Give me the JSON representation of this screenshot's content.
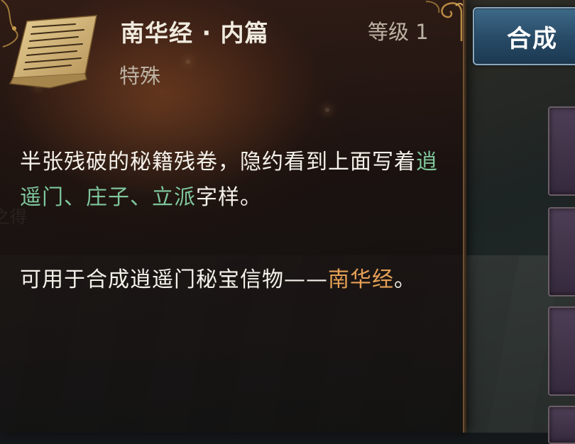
{
  "item": {
    "name": "南华经 · 内篇",
    "level": "等级 1",
    "category": "特殊",
    "icon": "scroll-manuscript-icon"
  },
  "description": {
    "para1": [
      {
        "text": "半张残破的秘籍残卷，隐约看到上面写着",
        "style": "normal"
      },
      {
        "text": "逍遥门、庄子、立派",
        "style": "green"
      },
      {
        "text": "字样。",
        "style": "normal"
      }
    ],
    "para2": [
      {
        "text": "可用于合成逍遥门秘宝信物——",
        "style": "normal"
      },
      {
        "text": "南华经",
        "style": "orange"
      },
      {
        "text": "。",
        "style": "normal"
      }
    ]
  },
  "actions": {
    "compose_label": "合成"
  },
  "background_text": "之得",
  "colors": {
    "highlight_green": "#7ec69c",
    "highlight_orange": "#e7a056",
    "button_blue": "#2f5878"
  }
}
